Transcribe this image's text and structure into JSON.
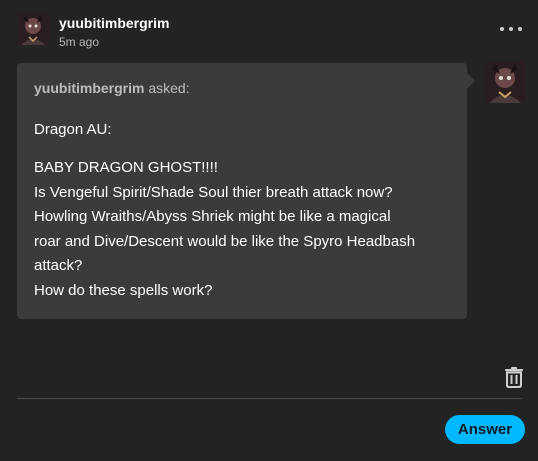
{
  "post": {
    "username": "yuubitimbergrim",
    "timestamp": "5m ago",
    "more_icon": "more-horizontal-icon"
  },
  "ask": {
    "asker": "yuubitimbergrim",
    "asked_suffix": " asked:",
    "paragraph1": "Dragon AU:",
    "lines": [
      "BABY DRAGON GHOST!!!!",
      "Is Vengeful Spirit/Shade Soul thier breath attack now?",
      "Howling Wraiths/Abyss Shriek might be like a magical",
      "roar and Dive/Descent would be like the Spyro Headbash",
      "attack?",
      "How do these spells work?"
    ]
  },
  "actions": {
    "delete_icon": "trash-icon",
    "answer_label": "Answer"
  },
  "colors": {
    "background": "#232323",
    "ask_box": "#3b3b3b",
    "accent": "#00b8ff"
  }
}
